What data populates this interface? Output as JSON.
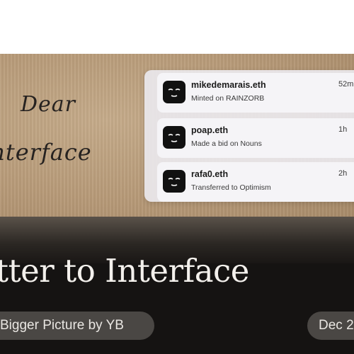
{
  "hero": {
    "line1": "Dear",
    "line2": "nterface"
  },
  "notifications": [
    {
      "name": "mikedemarais.eth",
      "action": "Minted on RAINZORB",
      "time": "52m"
    },
    {
      "name": "poap.eth",
      "action": "Made a bid on Nouns",
      "time": "1h"
    },
    {
      "name": "rafa0.eth",
      "action": "Transferred to Optimism",
      "time": "2h"
    }
  ],
  "article": {
    "title": "tter to Interface",
    "author_label": "Bigger Picture by YB",
    "date_label": "Dec 2"
  },
  "colors": {
    "footer_bg": "#151312",
    "pill_bg": "#4a4744",
    "avatar_bg": "#111111"
  },
  "icons": {
    "avatar": "sleepy-face-icon"
  }
}
